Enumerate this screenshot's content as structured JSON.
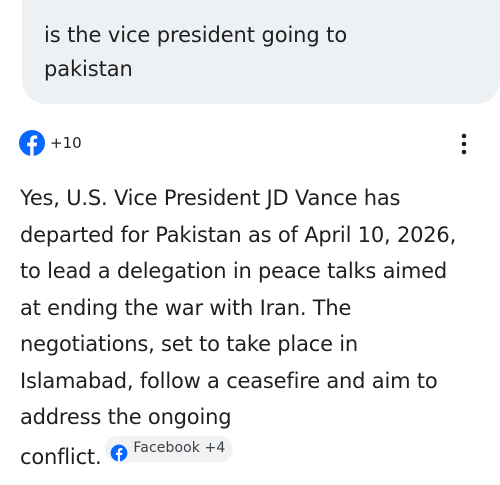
{
  "query": {
    "text": "is the vice president going to pakistan"
  },
  "sources": {
    "count_label": "+10",
    "icon": "facebook-icon"
  },
  "menu": {
    "icon": "more-vert-icon"
  },
  "answer": {
    "lines": [
      "Yes, U.S. Vice President JD Vance has",
      "departed for Pakistan as of April 10, 2026,",
      "to lead a delegation in peace talks aimed",
      "at ending the war with Iran. The",
      "negotiations, set to take place in",
      "Islamabad, follow a ceasefire and aim to",
      "address the ongoing",
      "conflict."
    ],
    "citation_chip": {
      "label": "Facebook +4",
      "icon": "facebook-icon"
    }
  },
  "colors": {
    "facebook_blue": "#0866ff",
    "bubble_bg": "#eef1f4",
    "chip_bg": "#f0f2f4",
    "text": "#1f1f1f"
  }
}
